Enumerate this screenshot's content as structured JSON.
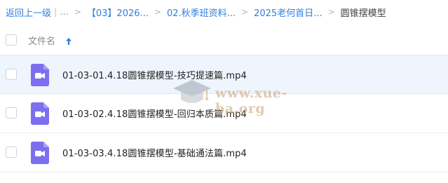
{
  "breadcrumb": {
    "back_label": "返回上一级",
    "ellipsis": "...",
    "items": [
      "【03】2026...",
      "02.秋季班资料...",
      "2025老何首日..."
    ],
    "current": "圆锥摆模型"
  },
  "table": {
    "name_header": "文件名"
  },
  "files": [
    {
      "name": "01-03-01.4.18圆锥摆模型-技巧提速篇.mp4"
    },
    {
      "name": "01-03-02.4.18圆锥摆模型-回归本质篇.mp4"
    },
    {
      "name": "01-03-03.4.18圆锥摆模型-基础通法篇.mp4"
    }
  ],
  "watermark": {
    "text": "www.xue-ba.org"
  },
  "colors": {
    "accent": "#2f7fe0",
    "video_icon": "#7b6ff0",
    "row_highlight": "#eef5fd"
  },
  "icons": {
    "sort": "arrow-up-icon",
    "file": "video-file-icon",
    "watermark": "graduation-cap-icon"
  }
}
